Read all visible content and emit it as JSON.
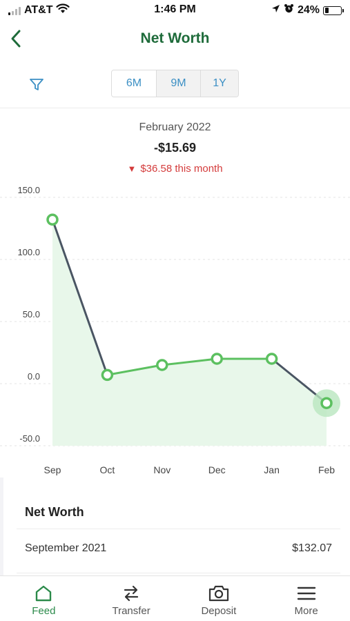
{
  "status_bar": {
    "carrier": "AT&T",
    "time": "1:46 PM",
    "battery": "24%",
    "battery_level": 0.24,
    "icons": [
      "signal-icon",
      "wifi-icon",
      "location-icon",
      "alarm-icon",
      "battery-icon"
    ]
  },
  "header": {
    "title": "Net Worth",
    "back_icon": "chevron-left-icon"
  },
  "toolbar": {
    "filter_icon": "filter-icon",
    "ranges": [
      {
        "label": "6M",
        "selected": true
      },
      {
        "label": "9M",
        "selected": false
      },
      {
        "label": "1Y",
        "selected": false
      }
    ]
  },
  "summary": {
    "month": "February 2022",
    "value": "-$15.69",
    "change": "$36.58 this month",
    "change_direction": "down"
  },
  "colors": {
    "brand_green": "#1e6b3a",
    "line_green": "#5cc060",
    "line_dark": "#4a5563",
    "area_fill": "#e8f7ea",
    "negative": "#d43b3b",
    "link_blue": "#3b8fc4"
  },
  "chart_data": {
    "type": "line",
    "categories": [
      "Sep",
      "Oct",
      "Nov",
      "Dec",
      "Jan",
      "Feb"
    ],
    "series": [
      {
        "values": [
          132.07,
          7.0,
          15.0,
          20.0,
          20.0,
          -15.69
        ]
      }
    ],
    "y_ticks": [
      "150.0",
      "100.0",
      "50.0",
      "0.0",
      "-50.0"
    ],
    "ylim": [
      -50,
      150
    ],
    "area_fill": true,
    "grid": true,
    "highlighted_index": 5
  },
  "net_worth": {
    "heading": "Net Worth",
    "rows": [
      {
        "label": "September 2021",
        "value": "$132.07"
      }
    ]
  },
  "tab_bar": {
    "tabs": [
      {
        "label": "Feed",
        "icon": "home-icon",
        "active": true
      },
      {
        "label": "Transfer",
        "icon": "transfer-icon",
        "active": false
      },
      {
        "label": "Deposit",
        "icon": "camera-icon",
        "active": false
      },
      {
        "label": "More",
        "icon": "menu-icon",
        "active": false
      }
    ]
  }
}
